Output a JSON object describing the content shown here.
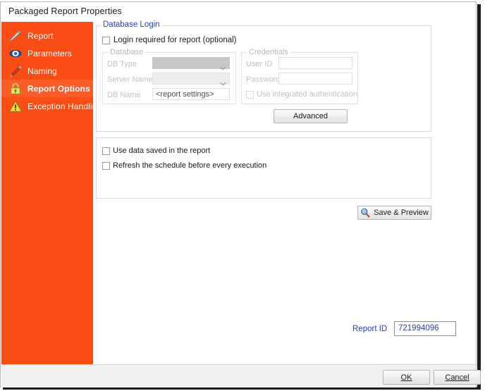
{
  "window": {
    "title": "Packaged Report Properties"
  },
  "sidebar": {
    "items": [
      {
        "label": "Report",
        "icon": "pen-icon",
        "active": false
      },
      {
        "label": "Parameters",
        "icon": "eye-icon",
        "active": false
      },
      {
        "label": "Naming",
        "icon": "pencil-icon",
        "active": false
      },
      {
        "label": "Report Options",
        "icon": "lock-icon",
        "active": true
      },
      {
        "label": "Exception Handling",
        "icon": "warning-triangle-icon",
        "active": false
      }
    ],
    "collapse_icon": "chevron-down-icon",
    "background_color": "#fa4d16",
    "active_color": "#fc5c28"
  },
  "database_login": {
    "panel_title": "Database Login",
    "login_required_checkbox": {
      "label": "Login required for report (optional)",
      "checked": false
    },
    "database_group": {
      "title": "Database",
      "db_type": {
        "label": "DB Type",
        "value": "",
        "disabled": true
      },
      "server_name": {
        "label": "Server Name",
        "value": "",
        "disabled": true
      },
      "db_name": {
        "label": "DB Name",
        "value": "<report settings>",
        "disabled": true
      }
    },
    "credentials_group": {
      "title": "Credentials",
      "user_id": {
        "label": "User ID",
        "value": "",
        "disabled": true
      },
      "password": {
        "label": "Password",
        "value": "",
        "disabled": true
      },
      "integrated_auth": {
        "label": "Use integrated authentication",
        "checked": false,
        "disabled": true
      }
    },
    "advanced_button": "Advanced"
  },
  "options_panel": {
    "use_saved_data": {
      "label": "Use data saved in the report",
      "checked": false
    },
    "refresh_schedule": {
      "label": "Refresh the schedule before every execution",
      "checked": false
    }
  },
  "save_preview_button": {
    "label": "Save & Preview",
    "icon": "magnifier-icon"
  },
  "report_id": {
    "label": "Report ID",
    "value": "721994096"
  },
  "footer": {
    "ok_label": "OK",
    "cancel_label": "Cancel"
  },
  "colors": {
    "accent": "#fa4d16",
    "link_blue": "#2a3fb0",
    "panel_border": "#dcdcdc"
  }
}
